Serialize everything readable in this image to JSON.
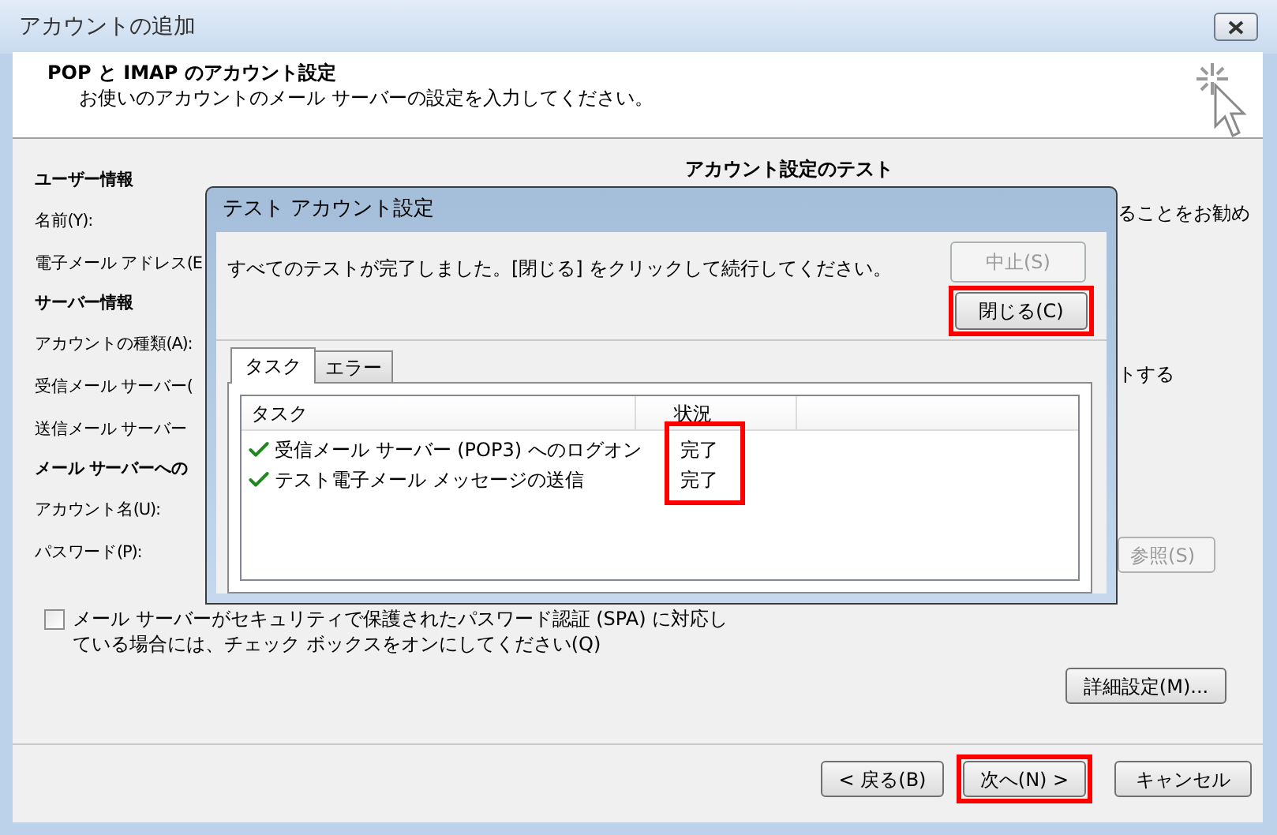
{
  "window": {
    "title": "アカウントの追加"
  },
  "header": {
    "title": "POP と IMAP のアカウント設定",
    "subtitle": "お使いのアカウントのメール サーバーの設定を入力してください。"
  },
  "left_sections": [
    {
      "heading": "ユーザー情報",
      "labels": [
        "名前(Y):",
        "電子メール アドレス(E"
      ]
    },
    {
      "heading": "サーバー情報",
      "labels": [
        "アカウントの種類(A):",
        "受信メール サーバー(",
        "送信メール サーバー"
      ]
    },
    {
      "heading": "メール サーバーへの",
      "labels": [
        "アカウント名(U):",
        "パスワード(P):"
      ]
    }
  ],
  "right": {
    "heading": "アカウント設定のテスト",
    "text_1": "ることをお勧め",
    "text_2": "トする",
    "browse_button": {
      "label": "参照(S)",
      "disabled": true
    }
  },
  "spa_checkbox": {
    "label_lines": [
      "メール サーバーがセキュリティで保護されたパスワード認証 (SPA) に対応し",
      "ている場合には、チェック ボックスをオンにしてください(Q)"
    ],
    "checked": false
  },
  "advanced_button": "詳細設定(M)...",
  "buttons": [
    {
      "label": "< 戻る(B)",
      "highlighted": false
    },
    {
      "label": "次へ(N) >",
      "highlighted": true
    },
    {
      "label": "キャンセル",
      "highlighted": false
    }
  ],
  "dialog": {
    "title": "テスト アカウント設定",
    "message": "すべてのテストが完了しました。[閉じる] をクリックして続行してください。",
    "stop_button": {
      "label": "中止(S)",
      "disabled": true
    },
    "close_button": {
      "label": "閉じる(C)",
      "highlighted": true
    },
    "tabs": [
      {
        "label": "タスク",
        "selected": true
      },
      {
        "label": "エラー",
        "selected": false
      }
    ],
    "columns": [
      "タスク",
      "状況"
    ],
    "rows": [
      {
        "task": "受信メール サーバー (POP3) へのログオン",
        "status": "完了",
        "done": true
      },
      {
        "task": "テスト電子メール メッセージの送信",
        "status": "完了",
        "done": true
      }
    ],
    "status_highlighted": true
  }
}
